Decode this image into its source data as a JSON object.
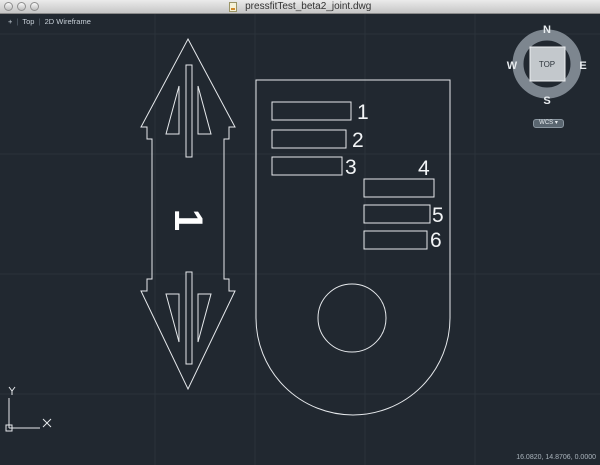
{
  "window": {
    "title": "pressfitTest_beta2_joint.dwg"
  },
  "viewport_controls": {
    "menu": "+",
    "view": "Top",
    "visual_style": "2D Wireframe"
  },
  "drawing": {
    "slot_labels": [
      "1",
      "2",
      "3",
      "4",
      "5",
      "6"
    ],
    "part_label": "1"
  },
  "view_cube": {
    "face": "TOP",
    "north": "N",
    "south": "S",
    "east": "E",
    "west": "W",
    "coordinate_system": "WCS"
  },
  "ucs": {
    "x_label": "X",
    "y_label": "Y"
  },
  "status": {
    "coordinates": "16.0820, 14.8706, 0.0000"
  },
  "colors": {
    "background": "#212830",
    "geometry": "#e6e9ec",
    "grid": "#2b323a"
  }
}
